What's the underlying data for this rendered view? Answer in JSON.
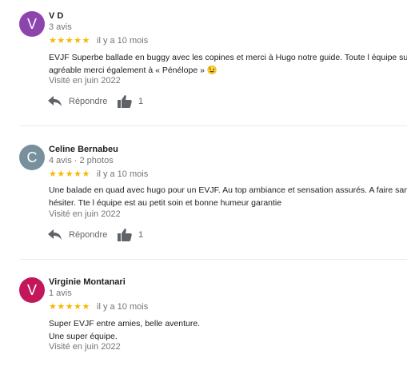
{
  "reviews": [
    {
      "avatar_letter": "V",
      "avatar_color": "#8e44ad",
      "name": "V D",
      "meta": "3 avis",
      "stars": "★★★★★",
      "rating": 5,
      "time": "il y a 10 mois",
      "text_lines": [
        "EVJF Superbe ballade en buggy avec les copines et merci à Hugo notre guide. Toute l équipe super",
        "agréable merci également à « Pénélope » 😉"
      ],
      "visited": "Visité en juin 2022",
      "reply_label": "Répondre",
      "likes": "1"
    },
    {
      "avatar_letter": "C",
      "avatar_color": "#78909c",
      "name": "Celine Bernabeu",
      "meta": "4 avis · 2 photos",
      "stars": "★★★★★",
      "rating": 5,
      "time": "il y a 10 mois",
      "text_lines": [
        "Une balade en quad avec hugo pour un EVJF. Au top ambiance et sensation assurés. A faire sans",
        "hésiter. Tte l équipe est au petit soin et bonne humeur garantie"
      ],
      "visited": "Visité en juin 2022",
      "reply_label": "Répondre",
      "likes": "1"
    },
    {
      "avatar_letter": "V",
      "avatar_color": "#c2185b",
      "name": "Virginie Montanari",
      "meta": "1 avis",
      "stars": "★★★★★",
      "rating": 5,
      "time": "il y a 10 mois",
      "text_lines": [
        "Super EVJF entre amies,  belle aventure.",
        "Une super équipe."
      ],
      "visited": "Visité en juin 2022"
    }
  ]
}
